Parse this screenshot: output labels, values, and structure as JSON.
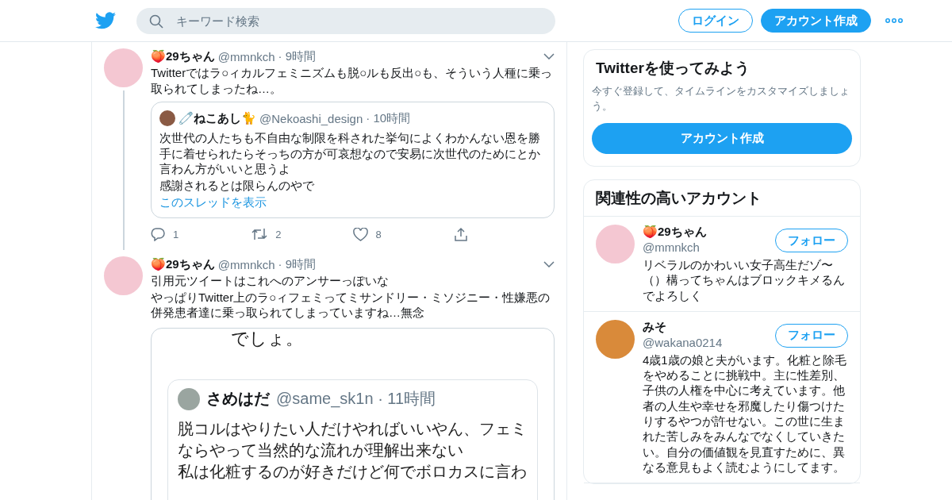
{
  "header": {
    "search": {
      "placeholder": "キーワード検索"
    },
    "login": "ログイン",
    "signup": "アカウント作成"
  },
  "tweets": [
    {
      "name": "🍑29ちゃん",
      "handle": "@mmnkch",
      "time": "· 9時間",
      "thread": true,
      "text": [
        "Twitterではラ○ィカルフェミニズムも脱○ルも反出○も、そういう人種に乗っ取られてしまったね…。"
      ],
      "quote": {
        "name": "🧷ねこあし🐈",
        "handle": "@Nekoashi_design",
        "time": "· 10時間",
        "text": [
          "次世代の人たちも不自由な制限を科された挙句によくわかんない恩を勝手に着せられたらそっちの方が可哀想なので安易に次世代のためにとか言わん方がいいと思うよ",
          "感謝されるとは限らんのやで"
        ],
        "link": "このスレッドを表示"
      },
      "replies": "1",
      "retweets": "2",
      "likes": "8"
    },
    {
      "name": "🍑29ちゃん",
      "handle": "@mmnkch",
      "time": "· 9時間",
      "thread": false,
      "text": [
        "引用元ツイートはこれへのアンサーっぽいな",
        "やっぱりTwitter上のラ○ィフェミってミサンドリー・ミソジニー・性嫌悪の併発患者達に乗っ取られてしまっていますね…無念"
      ],
      "screenshot": {
        "top_text": "でしょ。",
        "name": "さめはだ",
        "handle": "@same_sk1n · 11時間",
        "text": [
          "脱コルはやりたい人だけやればいいやん、フェミ",
          "ならやって当然的な流れが理解出来ない",
          "私は化粧するのが好きだけど何でボロカスに言わ"
        ]
      }
    }
  ],
  "signup_card": {
    "title": "Twitterを使ってみよう",
    "text": "今すぐ登録して、タイムラインをカスタマイズしましょう。",
    "button": "アカウント作成"
  },
  "related": {
    "title": "関連性の高いアカウント",
    "accounts": [
      {
        "name": "🍑29ちゃん",
        "handle": "@mmnkch",
        "follow": "フォロー",
        "bio": "リベラルのかわいい女子高生だゾ〜（）構ってちゃんはブロックキメるんでよろしく"
      },
      {
        "name": "みそ",
        "handle": "@wakana0214",
        "follow": "フォロー",
        "bio": "4歳1歳の娘と夫がいます。化粧と除毛をやめることに挑戦中。主に性差別、子供の人権を中心に考えています。他者の人生や幸せを邪魔したり傷つけたりするやつが許せない。この世に生まれた苦しみをみんなでなくしていきたい。自分の価値観を見直すために、異なる意見もよく読むようにしてます。"
      }
    ]
  }
}
